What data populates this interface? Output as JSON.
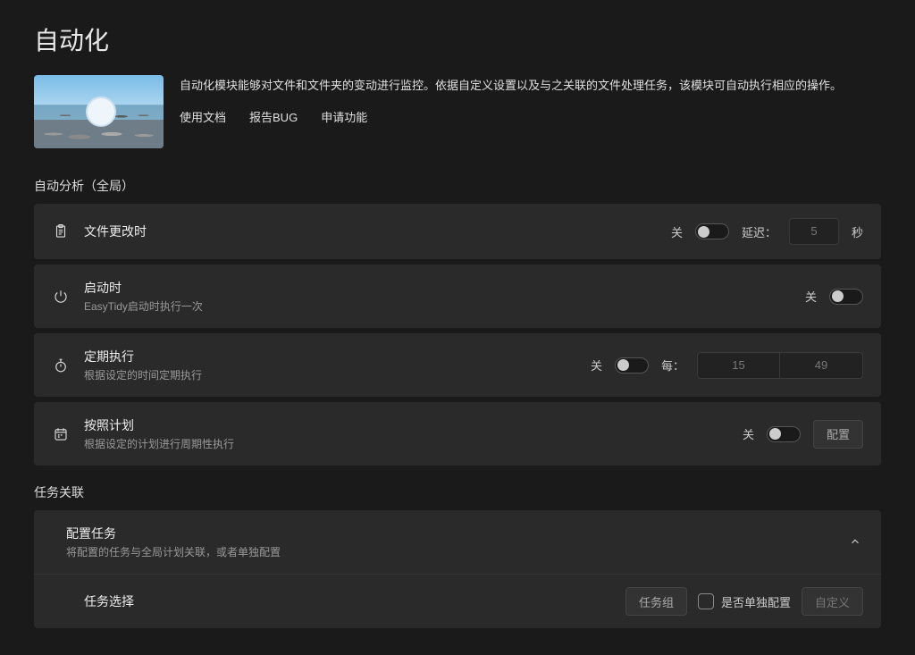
{
  "page_title": "自动化",
  "header": {
    "description": "自动化模块能够对文件和文件夹的变动进行监控。依据自定义设置以及与之关联的文件处理任务，该模块可自动执行相应的操作。",
    "links": {
      "docs": "使用文档",
      "bug": "报告BUG",
      "feature": "申请功能"
    }
  },
  "sections": {
    "auto_analysis": {
      "label": "自动分析（全局）",
      "file_change": {
        "title": "文件更改时",
        "toggle_label": "关",
        "delay_label": "延迟：",
        "delay_value": "5",
        "unit": "秒"
      },
      "startup": {
        "title": "启动时",
        "subtitle": "EasyTidy启动时执行一次",
        "toggle_label": "关"
      },
      "periodic": {
        "title": "定期执行",
        "subtitle": "根据设定的时间定期执行",
        "toggle_label": "关",
        "every_label": "每：",
        "value_a": "15",
        "value_b": "49"
      },
      "scheduled": {
        "title": "按照计划",
        "subtitle": "根据设定的计划进行周期性执行",
        "toggle_label": "关",
        "config_btn": "配置"
      }
    },
    "task_assoc": {
      "label": "任务关联",
      "config_task": {
        "title": "配置任务",
        "subtitle": "将配置的任务与全局计划关联，或者单独配置"
      },
      "task_select": {
        "label": "任务选择",
        "group_btn": "任务组",
        "checkbox_label": "是否单独配置",
        "custom_btn": "自定义"
      }
    }
  }
}
